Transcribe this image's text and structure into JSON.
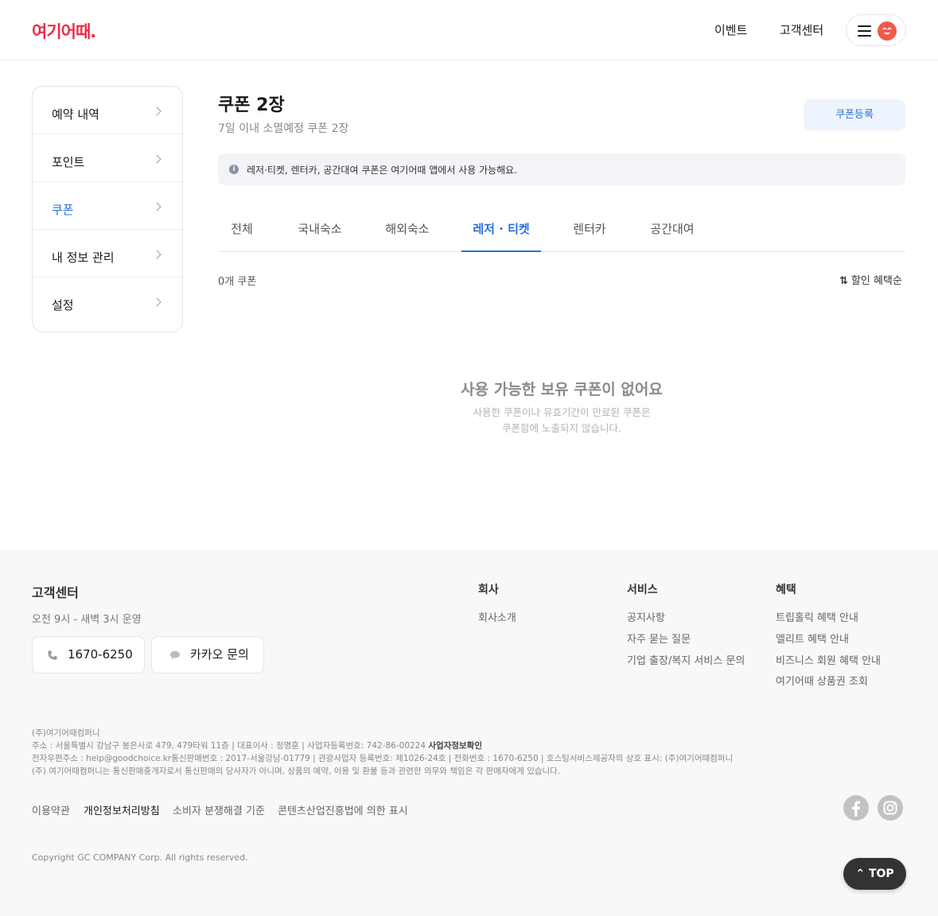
{
  "header": {
    "logo": "여기어때.",
    "nav": [
      "이벤트",
      "고객센터"
    ]
  },
  "sidebar": {
    "items": [
      {
        "label": "예약 내역"
      },
      {
        "label": "포인트"
      },
      {
        "label": "쿠폰"
      },
      {
        "label": "내 정보 관리"
      },
      {
        "label": "설정"
      }
    ],
    "active_index": 2
  },
  "main": {
    "title": "쿠폰 2장",
    "subtitle": "7일 이내 소멸예정 쿠폰 2장",
    "register_label": "쿠폰등록",
    "notice": "레저·티켓, 렌터카, 공간대여 쿠폰은 여기어때 앱에서 사용 가능해요.",
    "tabs": [
      "전체",
      "국내숙소",
      "해외숙소",
      "레저 · 티켓",
      "렌터카",
      "공간대여"
    ],
    "active_tab": 3,
    "count_label": "0개 쿠폰",
    "sort_label": "할인 혜택순",
    "empty_title": "사용 가능한 보유 쿠폰이 없어요",
    "empty_line1": "사용한 쿠폰이나 유효기간이 만료된 쿠폰은",
    "empty_line2": "쿠폰함에 노출되지 않습니다."
  },
  "footer": {
    "cs_title": "고객센터",
    "cs_hours": "오전 9시 - 새벽 3시 운영",
    "phone": "1670-6250",
    "kakao": "카카오 문의",
    "columns": [
      {
        "heading": "회사",
        "links": [
          "회사소개"
        ]
      },
      {
        "heading": "서비스",
        "links": [
          "공지사항",
          "자주 묻는 질문",
          "기업 출장/복지 서비스 문의"
        ]
      },
      {
        "heading": "혜택",
        "links": [
          "트립홀릭 혜택 안내",
          "엘리트 혜택 안내",
          "비즈니스 회원 혜택 안내",
          "여기어때 상품권 조회"
        ]
      }
    ],
    "legal_company": "(주)여기어때컴퍼니",
    "legal_address": "주소 : 서울특별시 강남구 봉은사로 479, 479타워 11층 | 대표이사 : 정명훈 | 사업자등록번호: 742-86-00224 ",
    "legal_biz_link": "사업자정보확인",
    "legal_line3": "전자우편주소 : help@goodchoice.kr통신판매번호 : 2017-서울강남-01779 | 관광사업자 등록번호: 제1026-24호 | 전화번호 : 1670-6250 | 호스팅서비스제공자의 상호 표시: (주)여기어때컴퍼니",
    "legal_line4": "(주) 여기어때컴퍼니는 통신판매중개자로서 통신판매의 당사자가 아니며, 상품의 예약, 이용 및 환불 등과 관련한 의무와 책임은 각 판매자에게 있습니다.",
    "policies": [
      "이용약관",
      "개인정보처리방침",
      "소비자 분쟁해결 기준",
      "콘텐츠산업진흥법에 의한 표시"
    ],
    "copyright": "Copyright GC COMPANY Corp. All rights reserved.",
    "top_label": "TOP"
  },
  "colors": {
    "brand": "#ea2d4b",
    "accent": "#2b6fd9"
  }
}
